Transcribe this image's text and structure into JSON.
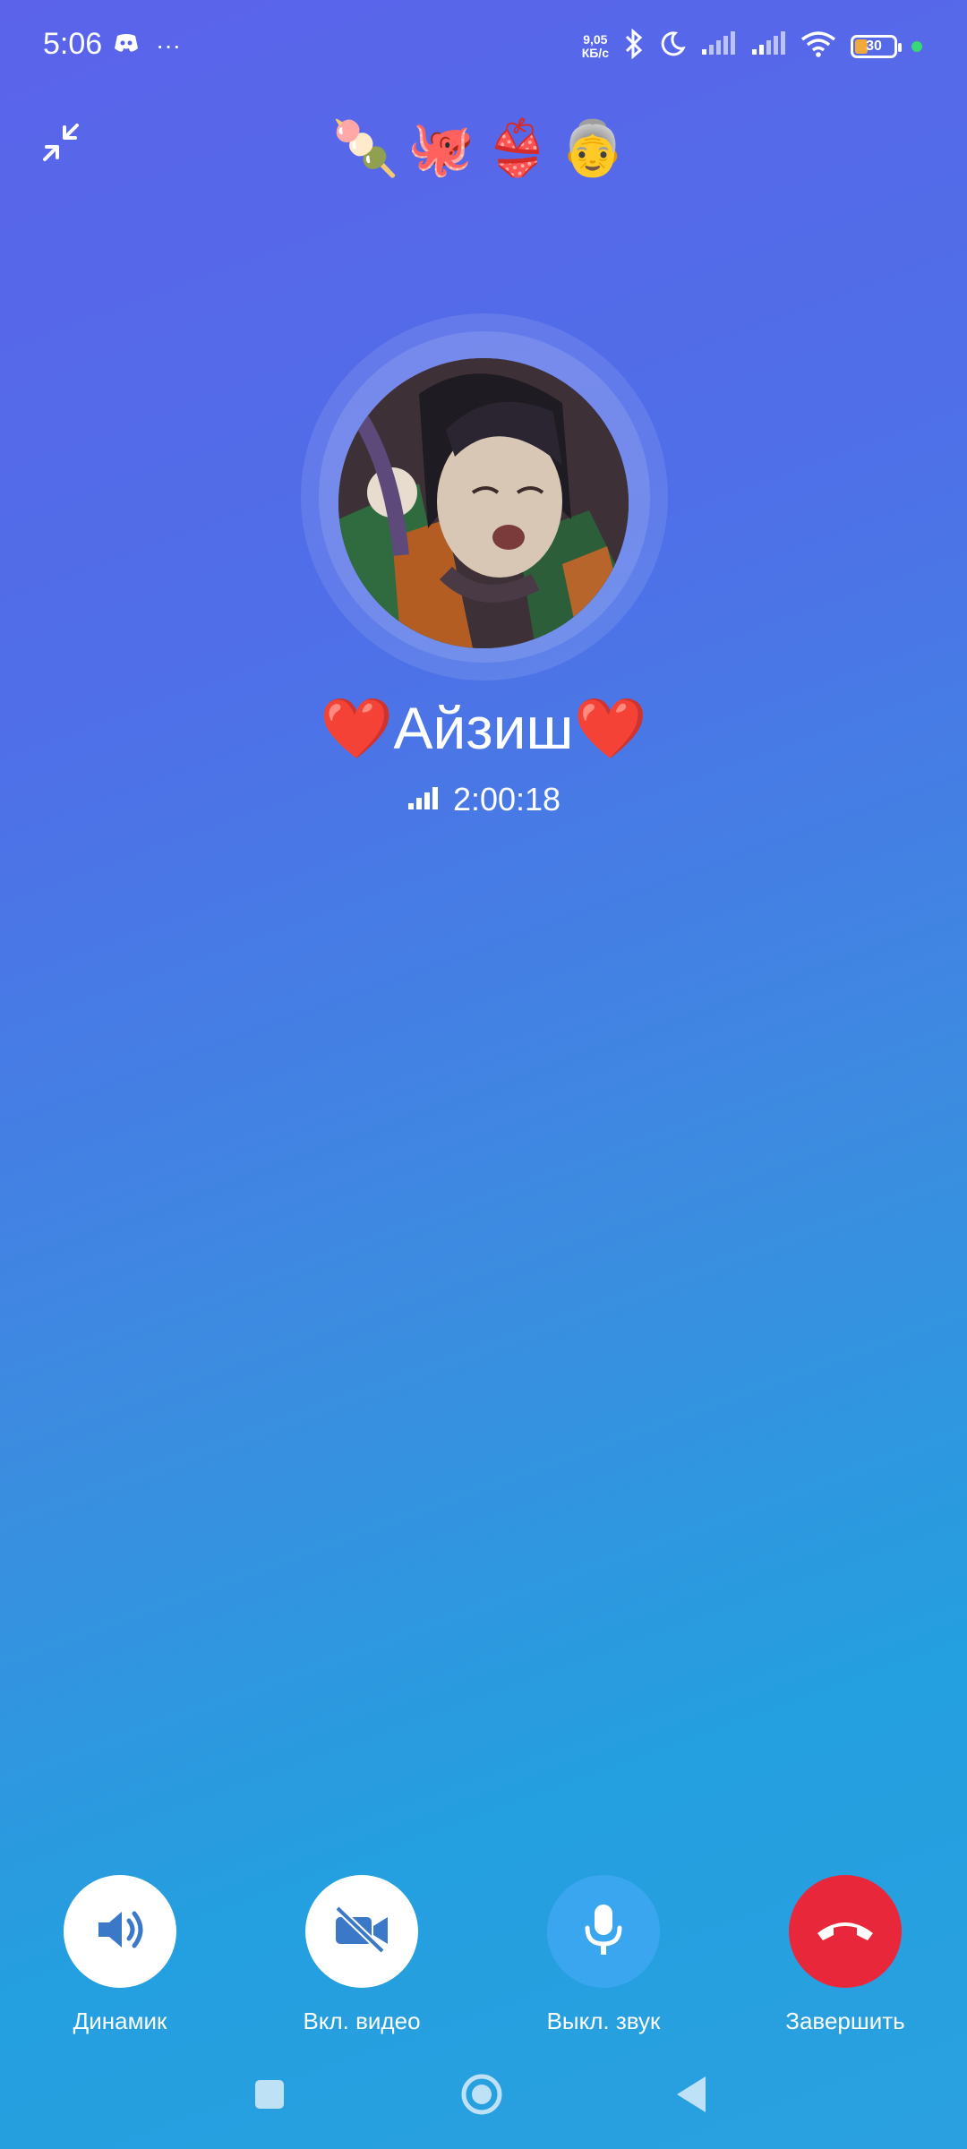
{
  "status_bar": {
    "time": "5:06",
    "net_speed_value": "9,05",
    "net_speed_unit": "КБ/с",
    "battery": "30",
    "dots": "···"
  },
  "emoji_key": "🍡🐙👙👵",
  "caller": {
    "name": "❤️Айзиш❤️",
    "duration": "2:00:18"
  },
  "controls": [
    {
      "label": "Динамик",
      "icon": "speaker-icon"
    },
    {
      "label": "Вкл. видео",
      "icon": "video-off-icon"
    },
    {
      "label": "Выкл. звук",
      "icon": "mic-icon"
    },
    {
      "label": "Завершить",
      "icon": "end-call-icon"
    }
  ],
  "colors": {
    "end_call": "#e8283a",
    "mic_button": "#3aa6f0",
    "icon_blue": "#3b78c8"
  }
}
